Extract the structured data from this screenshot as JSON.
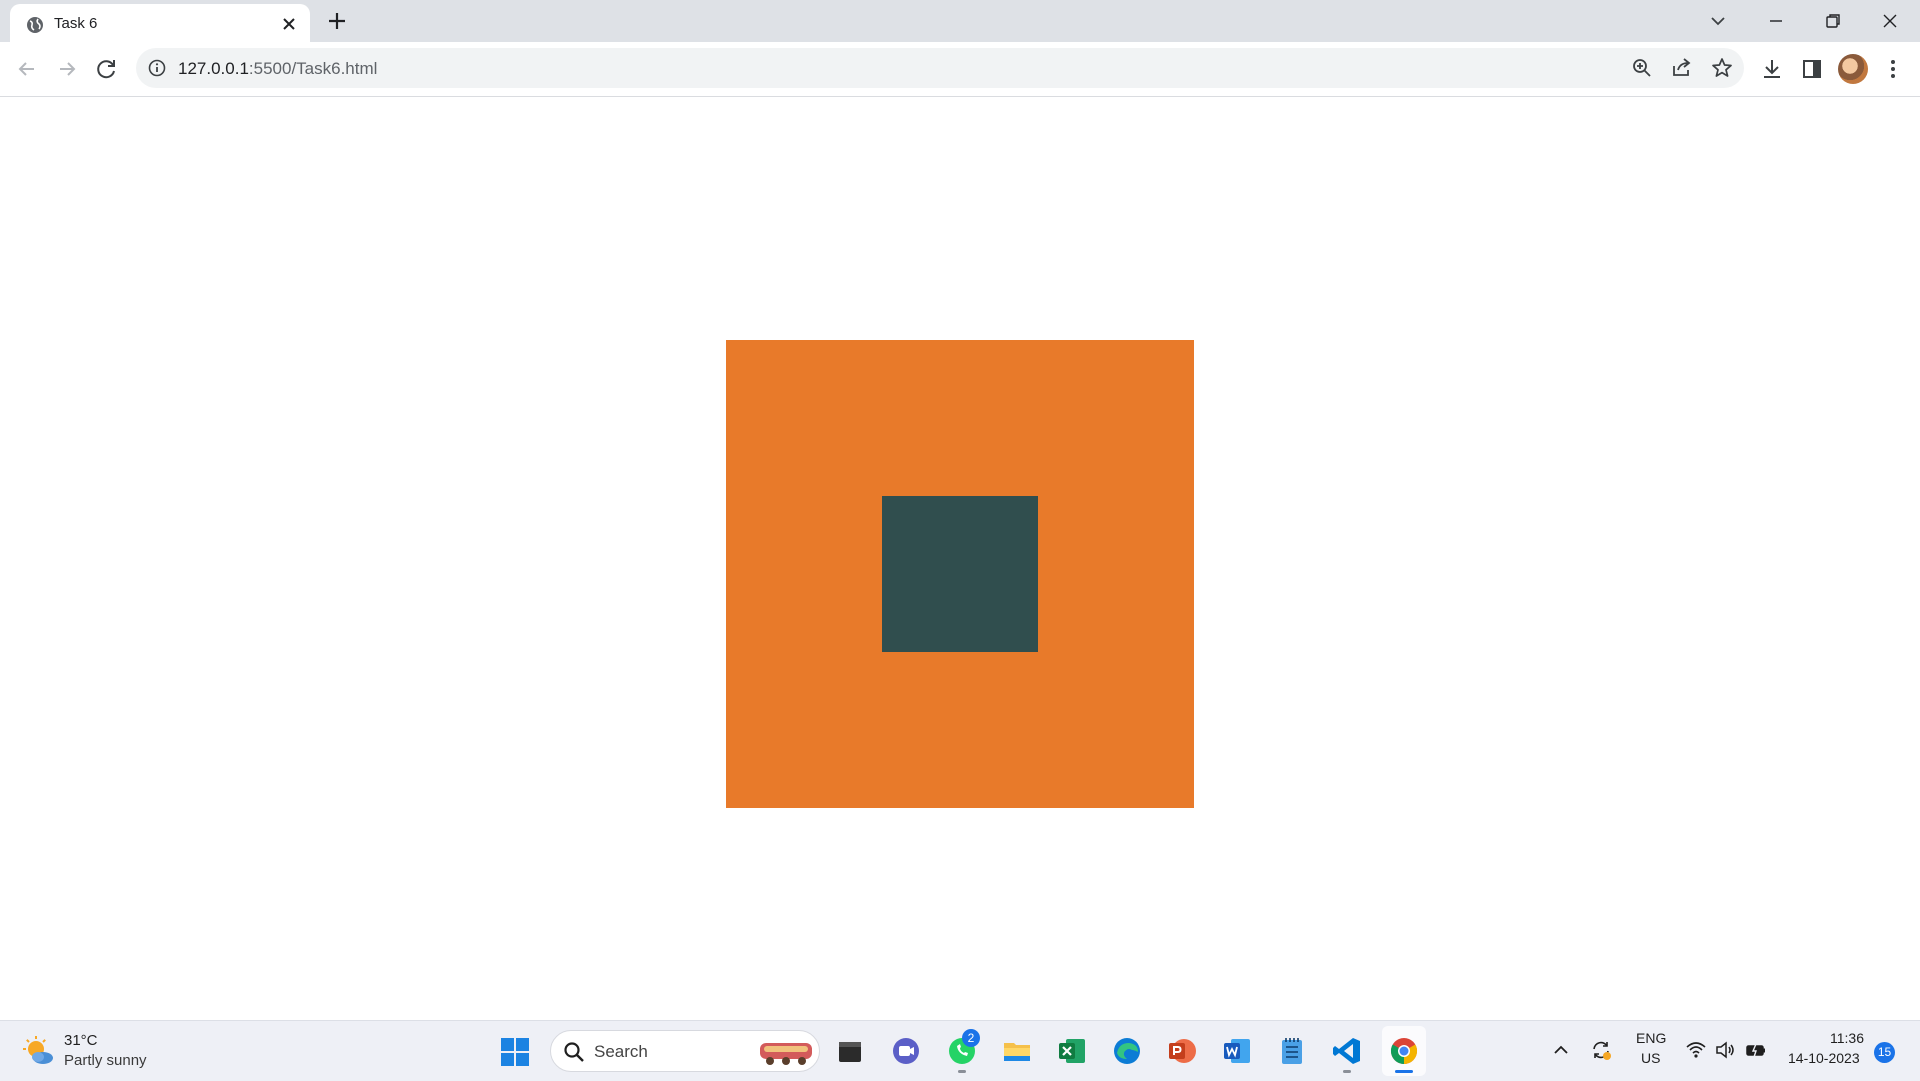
{
  "browser": {
    "tab": {
      "title": "Task 6"
    },
    "address": {
      "host": "127.0.0.1",
      "rest": ":5500/Task6.html"
    }
  },
  "page": {
    "colors": {
      "outer": "#e87a2a",
      "inner": "#304e4e",
      "background": "#ffffff"
    }
  },
  "taskbar": {
    "weather": {
      "temperature": "31°C",
      "condition": "Partly sunny",
      "icon": "partly-sunny-icon"
    },
    "search": {
      "placeholder": "Search"
    },
    "pinned_apps": [
      "file-explorer",
      "teams",
      "whatsapp",
      "folder",
      "excel",
      "edge",
      "powerpoint",
      "word",
      "notepad",
      "vscode",
      "chrome"
    ],
    "whatsapp_badge": "2",
    "tray": {
      "language": "ENG",
      "region": "US",
      "time": "11:36",
      "date": "14-10-2023",
      "notifications": "15"
    }
  }
}
